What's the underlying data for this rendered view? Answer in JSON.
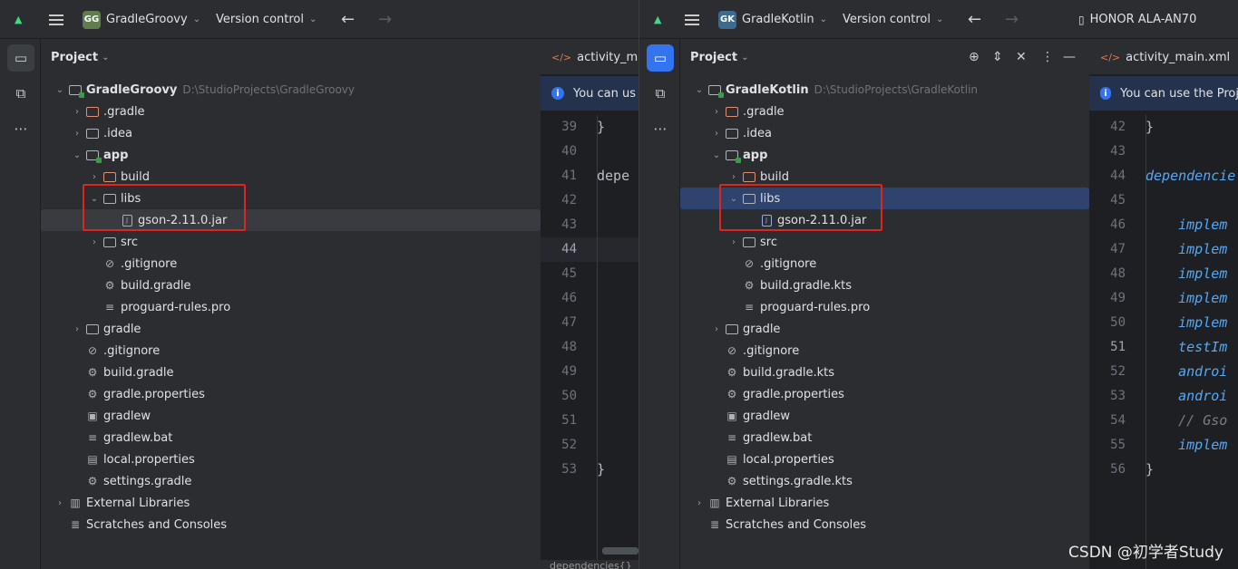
{
  "left": {
    "project_badge": "GG",
    "project_name": "GradleGroovy",
    "vcs_menu": "Version control",
    "panel_title": "Project",
    "tree": [
      {
        "label": "GradleGroovy",
        "path": "D:\\StudioProjects\\GradleGroovy",
        "icon": "module-folder",
        "arrow": "expanded",
        "bold": true
      },
      {
        "label": ".gradle",
        "icon": "excluded-folder",
        "arrow": "collapsed"
      },
      {
        "label": ".idea",
        "icon": "folder",
        "arrow": "collapsed"
      },
      {
        "label": "app",
        "icon": "module-folder",
        "arrow": "expanded",
        "bold": true
      },
      {
        "label": "build",
        "icon": "excluded-folder",
        "arrow": "collapsed"
      },
      {
        "label": "libs",
        "icon": "folder",
        "arrow": "expanded"
      },
      {
        "label": "gson-2.11.0.jar",
        "icon": "jar-file",
        "arrow": "none"
      },
      {
        "label": "src",
        "icon": "folder",
        "arrow": "collapsed"
      },
      {
        "label": ".gitignore",
        "icon": "ignore-file",
        "arrow": "none"
      },
      {
        "label": "build.gradle",
        "icon": "gradle-file",
        "arrow": "none"
      },
      {
        "label": "proguard-rules.pro",
        "icon": "text-file",
        "arrow": "none"
      },
      {
        "label": "gradle",
        "icon": "folder",
        "arrow": "collapsed"
      },
      {
        "label": ".gitignore",
        "icon": "ignore-file",
        "arrow": "none"
      },
      {
        "label": "build.gradle",
        "icon": "gradle-file",
        "arrow": "none"
      },
      {
        "label": "gradle.properties",
        "icon": "settings-file",
        "arrow": "none"
      },
      {
        "label": "gradlew",
        "icon": "terminal-file",
        "arrow": "none"
      },
      {
        "label": "gradlew.bat",
        "icon": "text-file",
        "arrow": "none"
      },
      {
        "label": "local.properties",
        "icon": "properties-file",
        "arrow": "none"
      },
      {
        "label": "settings.gradle",
        "icon": "gradle-file",
        "arrow": "none"
      },
      {
        "label": "External Libraries",
        "icon": "library",
        "arrow": "collapsed"
      },
      {
        "label": "Scratches and Consoles",
        "icon": "scratches",
        "arrow": "none"
      }
    ],
    "editor_tab": "activity_main",
    "banner": "You can us",
    "line_numbers": [
      "39",
      "40",
      "41",
      "42",
      "43",
      "44",
      "45",
      "46",
      "47",
      "48",
      "49",
      "50",
      "51",
      "52",
      "53"
    ],
    "current_line": "44",
    "code_lines": [
      "}",
      "",
      "depe",
      "",
      "",
      "",
      "",
      "",
      "",
      "",
      "",
      "",
      "",
      "",
      "}"
    ],
    "status_text": "dependencies{}"
  },
  "right": {
    "project_badge": "GK",
    "project_name": "GradleKotlin",
    "vcs_menu": "Version control",
    "device": "HONOR ALA-AN70",
    "panel_title": "Project",
    "tree": [
      {
        "label": "GradleKotlin",
        "path": "D:\\StudioProjects\\GradleKotlin",
        "icon": "module-folder",
        "arrow": "expanded",
        "bold": true
      },
      {
        "label": ".gradle",
        "icon": "excluded-folder",
        "arrow": "collapsed"
      },
      {
        "label": ".idea",
        "icon": "folder",
        "arrow": "collapsed"
      },
      {
        "label": "app",
        "icon": "module-folder",
        "arrow": "expanded",
        "bold": true
      },
      {
        "label": "build",
        "icon": "excluded-folder",
        "arrow": "collapsed"
      },
      {
        "label": "libs",
        "icon": "folder",
        "arrow": "expanded"
      },
      {
        "label": "gson-2.11.0.jar",
        "icon": "jar-file",
        "arrow": "none"
      },
      {
        "label": "src",
        "icon": "folder",
        "arrow": "collapsed"
      },
      {
        "label": ".gitignore",
        "icon": "ignore-file",
        "arrow": "none"
      },
      {
        "label": "build.gradle.kts",
        "icon": "gradle-file",
        "arrow": "none"
      },
      {
        "label": "proguard-rules.pro",
        "icon": "text-file",
        "arrow": "none"
      },
      {
        "label": "gradle",
        "icon": "folder",
        "arrow": "collapsed"
      },
      {
        "label": ".gitignore",
        "icon": "ignore-file",
        "arrow": "none"
      },
      {
        "label": "build.gradle.kts",
        "icon": "gradle-file",
        "arrow": "none"
      },
      {
        "label": "gradle.properties",
        "icon": "settings-file",
        "arrow": "none"
      },
      {
        "label": "gradlew",
        "icon": "terminal-file",
        "arrow": "none"
      },
      {
        "label": "gradlew.bat",
        "icon": "text-file",
        "arrow": "none"
      },
      {
        "label": "local.properties",
        "icon": "properties-file",
        "arrow": "none"
      },
      {
        "label": "settings.gradle.kts",
        "icon": "gradle-file",
        "arrow": "none"
      },
      {
        "label": "External Libraries",
        "icon": "library",
        "arrow": "collapsed"
      },
      {
        "label": "Scratches and Consoles",
        "icon": "scratches",
        "arrow": "none"
      }
    ],
    "editor_tab": "activity_main.xml",
    "banner": "You can use the Proj",
    "line_numbers": [
      "42",
      "43",
      "44",
      "45",
      "46",
      "47",
      "48",
      "49",
      "50",
      "51",
      "52",
      "53",
      "54",
      "55",
      "56"
    ],
    "current_line": "51",
    "code_lines": [
      {
        "text": "}",
        "style": "plain"
      },
      {
        "text": "",
        "style": "plain"
      },
      {
        "text": "dependencie",
        "style": "kw"
      },
      {
        "text": "",
        "style": "plain"
      },
      {
        "text": "    implem",
        "style": "kw"
      },
      {
        "text": "    implem",
        "style": "kw"
      },
      {
        "text": "    implem",
        "style": "kw"
      },
      {
        "text": "    implem",
        "style": "kw"
      },
      {
        "text": "    implem",
        "style": "kw"
      },
      {
        "text": "    testIm",
        "style": "kw"
      },
      {
        "text": "    androi",
        "style": "kw"
      },
      {
        "text": "    androi",
        "style": "kw"
      },
      {
        "text": "    // Gso",
        "style": "cm"
      },
      {
        "text": "    implem",
        "style": "kw"
      },
      {
        "text": "}",
        "style": "plain"
      }
    ]
  },
  "watermark": "CSDN @初学者Study",
  "colors": {
    "accent": "#3574f0",
    "highlight_box": "#e0241e",
    "selection": "#2e436e"
  }
}
